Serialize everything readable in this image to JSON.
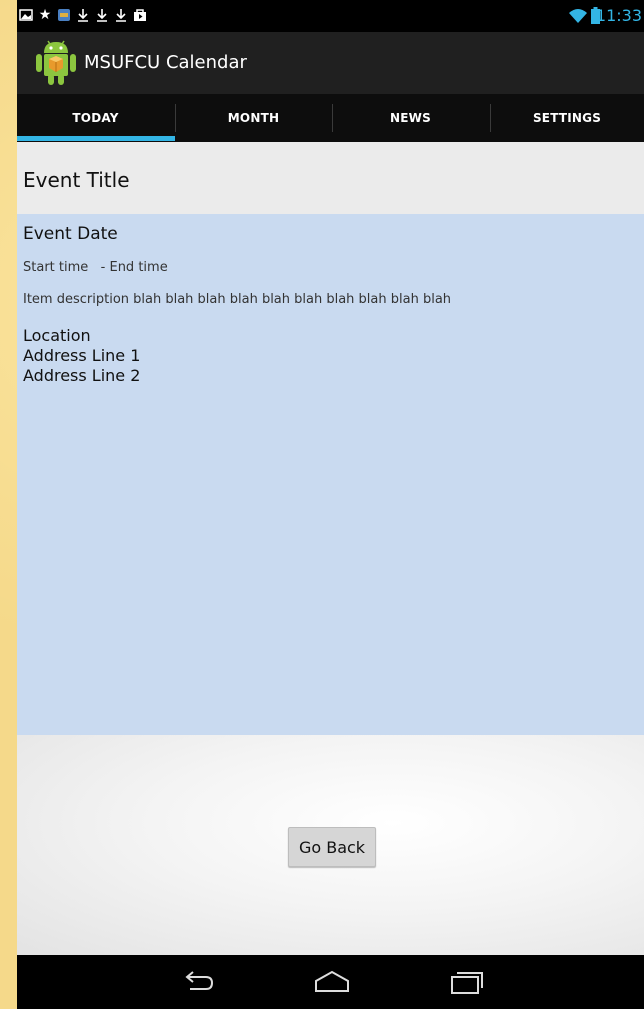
{
  "status_bar": {
    "time": "11:33",
    "notification_icons": [
      "gallery-icon",
      "star-icon",
      "app-icon",
      "download-icon",
      "download-icon",
      "download-icon",
      "shopping-bag-icon"
    ],
    "wifi_icon": "wifi-icon",
    "battery_icon": "battery-icon",
    "accent_color": "#33b5e5"
  },
  "action_bar": {
    "title": "MSUFCU Calendar",
    "icon": "android-icon"
  },
  "tabs": [
    {
      "label": "TODAY",
      "selected": true
    },
    {
      "label": "MONTH",
      "selected": false
    },
    {
      "label": "NEWS",
      "selected": false
    },
    {
      "label": "SETTINGS",
      "selected": false
    }
  ],
  "event": {
    "title": "Event Title",
    "date": "Event Date",
    "times": "Start time   - End time",
    "description": "Item description blah blah blah blah blah blah blah blah blah blah",
    "location": "Location",
    "address_line_1": "Address Line 1",
    "address_line_2": "Address Line 2"
  },
  "actions": {
    "go_back_label": "Go Back"
  },
  "nav_bar": {
    "buttons": [
      "back-icon",
      "home-icon",
      "recent-apps-icon"
    ]
  },
  "colors": {
    "details_background": "#c9daf0",
    "title_background": "#ebebeb",
    "tab_indicator": "#33b5e5"
  }
}
